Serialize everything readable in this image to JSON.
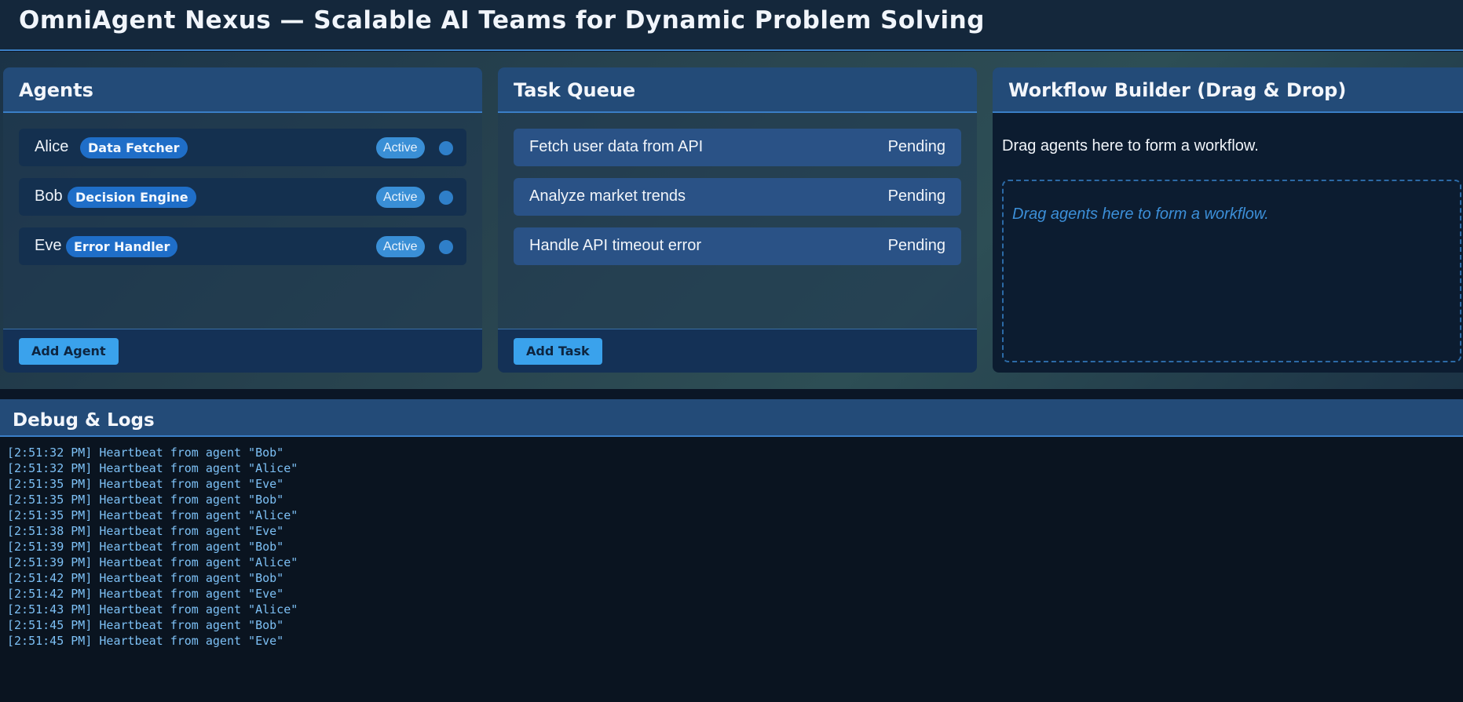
{
  "app": {
    "title": "OmniAgent Nexus — Scalable AI Teams for Dynamic Problem Solving"
  },
  "agents_panel": {
    "title": "Agents",
    "add_button": "Add Agent",
    "agents": [
      {
        "name": "Alice",
        "role": "Data Fetcher",
        "status": "Active"
      },
      {
        "name": "Bob",
        "role": "Decision Engine",
        "status": "Active"
      },
      {
        "name": "Eve",
        "role": "Error Handler",
        "status": "Active"
      }
    ]
  },
  "task_panel": {
    "title": "Task Queue",
    "add_button": "Add Task",
    "tasks": [
      {
        "label": "Fetch user data from API",
        "status": "Pending"
      },
      {
        "label": "Analyze market trends",
        "status": "Pending"
      },
      {
        "label": "Handle API timeout error",
        "status": "Pending"
      }
    ]
  },
  "workflow_panel": {
    "title": "Workflow Builder (Drag & Drop)",
    "hint": "Drag agents here to form a workflow.",
    "drop_zone_placeholder": "Drag agents here to form a workflow."
  },
  "debug": {
    "title": "Debug & Logs",
    "logs": [
      "[2:51:32 PM] Heartbeat from agent \"Bob\"",
      "[2:51:32 PM] Heartbeat from agent \"Alice\"",
      "[2:51:35 PM] Heartbeat from agent \"Eve\"",
      "[2:51:35 PM] Heartbeat from agent \"Bob\"",
      "[2:51:35 PM] Heartbeat from agent \"Alice\"",
      "[2:51:38 PM] Heartbeat from agent \"Eve\"",
      "[2:51:39 PM] Heartbeat from agent \"Bob\"",
      "[2:51:39 PM] Heartbeat from agent \"Alice\"",
      "[2:51:42 PM] Heartbeat from agent \"Bob\"",
      "[2:51:42 PM] Heartbeat from agent \"Eve\"",
      "[2:51:43 PM] Heartbeat from agent \"Alice\"",
      "[2:51:45 PM] Heartbeat from agent \"Bob\"",
      "[2:51:45 PM] Heartbeat from agent \"Eve\""
    ]
  },
  "colors": {
    "accent": "#3aa2ec",
    "panel_header": "#234b78",
    "role_badge": "#1f6ec8",
    "status_active": "#3a8fd6",
    "log_text": "#7dc0f5"
  }
}
